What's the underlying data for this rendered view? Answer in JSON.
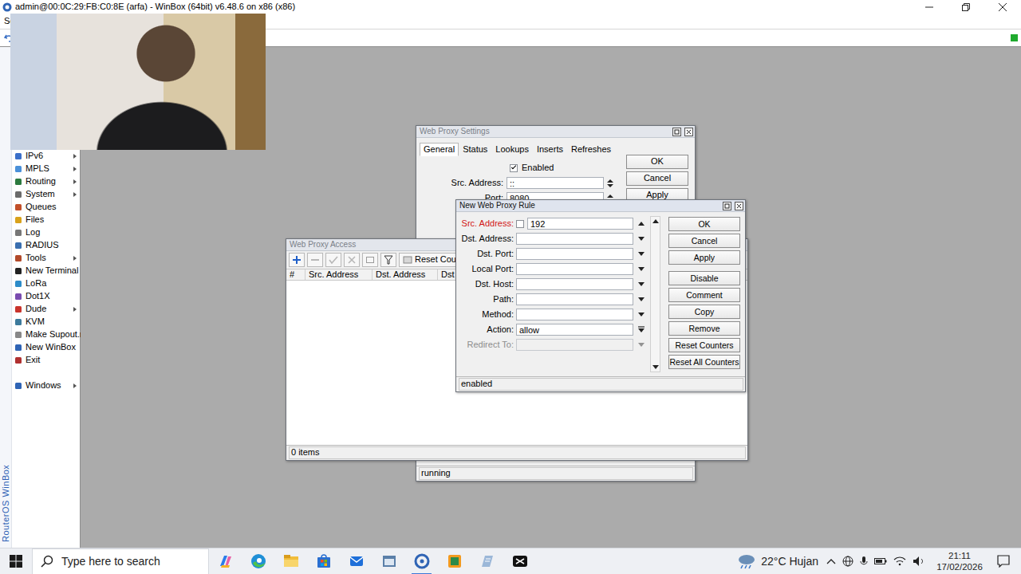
{
  "window": {
    "title": "admin@00:0C:29:FB:C0:8E (arfa) - WinBox (64bit) v6.48.6 on x86 (x86)"
  },
  "menu_bar": {
    "text": "Se"
  },
  "sidebar": {
    "brand": "RouterOS WinBox",
    "items": [
      {
        "label": "IPv6",
        "submenu": true
      },
      {
        "label": "MPLS",
        "submenu": true
      },
      {
        "label": "Routing",
        "submenu": true
      },
      {
        "label": "System",
        "submenu": true
      },
      {
        "label": "Queues",
        "submenu": false
      },
      {
        "label": "Files",
        "submenu": false
      },
      {
        "label": "Log",
        "submenu": false
      },
      {
        "label": "RADIUS",
        "submenu": false
      },
      {
        "label": "Tools",
        "submenu": true
      },
      {
        "label": "New Terminal",
        "submenu": false
      },
      {
        "label": "LoRa",
        "submenu": false
      },
      {
        "label": "Dot1X",
        "submenu": false
      },
      {
        "label": "Dude",
        "submenu": true
      },
      {
        "label": "KVM",
        "submenu": false
      },
      {
        "label": "Make Supout.rif",
        "submenu": false
      },
      {
        "label": "New WinBox",
        "submenu": false
      },
      {
        "label": "Exit",
        "submenu": false
      }
    ],
    "windows_item": {
      "label": "Windows",
      "submenu": true
    }
  },
  "proxy_settings": {
    "title": "Web Proxy Settings",
    "tabs": [
      {
        "label": "General",
        "selected": true
      },
      {
        "label": "Status",
        "selected": false
      },
      {
        "label": "Lookups",
        "selected": false
      },
      {
        "label": "Inserts",
        "selected": false
      },
      {
        "label": "Refreshes",
        "selected": false
      }
    ],
    "enabled": {
      "label": "Enabled",
      "checked": true
    },
    "fields": [
      {
        "label": "Src. Address:",
        "value": "::"
      },
      {
        "label": "Port:",
        "value": "8080"
      }
    ],
    "buttons": [
      "OK",
      "Cancel",
      "Apply"
    ],
    "status": "running"
  },
  "proxy_access": {
    "title": "Web Proxy Access",
    "reset_button": "Reset Counters",
    "columns": [
      "#",
      "Src. Address",
      "Dst. Address",
      "Dst"
    ],
    "status": "0 items"
  },
  "rule_dialog": {
    "title": "New Web Proxy Rule",
    "fields": [
      {
        "label": "Src. Address:",
        "value": "192",
        "kind": "negate",
        "negated": false,
        "invalid": true,
        "disabled": false
      },
      {
        "label": "Dst. Address:",
        "value": "",
        "kind": "combo",
        "invalid": false,
        "disabled": false
      },
      {
        "label": "Dst. Port:",
        "value": "",
        "kind": "combo",
        "invalid": false,
        "disabled": false
      },
      {
        "label": "Local Port:",
        "value": "",
        "kind": "combo",
        "invalid": false,
        "disabled": false
      },
      {
        "label": "Dst. Host:",
        "value": "",
        "kind": "combo",
        "invalid": false,
        "disabled": false
      },
      {
        "label": "Path:",
        "value": "",
        "kind": "combo",
        "invalid": false,
        "disabled": false
      },
      {
        "label": "Method:",
        "value": "",
        "kind": "combo",
        "invalid": false,
        "disabled": false
      },
      {
        "label": "Action:",
        "value": "allow",
        "kind": "select",
        "invalid": false,
        "disabled": false
      },
      {
        "label": "Redirect To:",
        "value": "",
        "kind": "combo",
        "invalid": false,
        "disabled": true
      }
    ],
    "buttons": [
      "OK",
      "Cancel",
      "Apply",
      "Disable",
      "Comment",
      "Copy",
      "Remove",
      "Reset Counters",
      "Reset All Counters"
    ],
    "status": "enabled"
  },
  "taskbar": {
    "search_placeholder": "Type here to search",
    "weather": "22°C Hujan",
    "time": "21:11",
    "date": "17/02/2026"
  }
}
